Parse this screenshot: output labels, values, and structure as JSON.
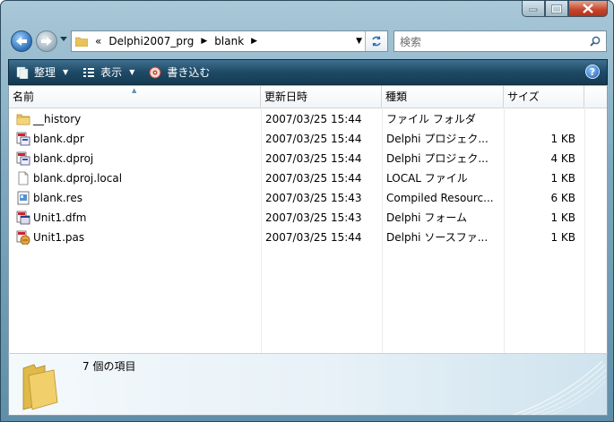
{
  "address": {
    "prefix": "«",
    "crumbs": [
      "Delphi2007_prg",
      "blank"
    ]
  },
  "search": {
    "placeholder": "検索"
  },
  "toolbar": {
    "organize": "整理",
    "views": "表示",
    "burn": "書き込む",
    "help": "?"
  },
  "columns": {
    "name": "名前",
    "date": "更新日時",
    "type": "種類",
    "size": "サイズ"
  },
  "files": [
    {
      "name": "__history",
      "date": "2007/03/25 15:44",
      "type": "ファイル フォルダ",
      "size": "",
      "icon": "folder-icon"
    },
    {
      "name": "blank.dpr",
      "date": "2007/03/25 15:44",
      "type": "Delphi プロジェク...",
      "size": "1 KB",
      "icon": "delphi-project-icon"
    },
    {
      "name": "blank.dproj",
      "date": "2007/03/25 15:44",
      "type": "Delphi プロジェク...",
      "size": "4 KB",
      "icon": "delphi-project-icon"
    },
    {
      "name": "blank.dproj.local",
      "date": "2007/03/25 15:44",
      "type": "LOCAL ファイル",
      "size": "1 KB",
      "icon": "generic-file-icon"
    },
    {
      "name": "blank.res",
      "date": "2007/03/25 15:43",
      "type": "Compiled Resourc...",
      "size": "6 KB",
      "icon": "resource-file-icon"
    },
    {
      "name": "Unit1.dfm",
      "date": "2007/03/25 15:43",
      "type": "Delphi フォーム",
      "size": "1 KB",
      "icon": "delphi-form-icon"
    },
    {
      "name": "Unit1.pas",
      "date": "2007/03/25 15:44",
      "type": "Delphi ソースファ...",
      "size": "1 KB",
      "icon": "delphi-source-icon"
    }
  ],
  "details": {
    "count_text": "7 個の項目"
  }
}
